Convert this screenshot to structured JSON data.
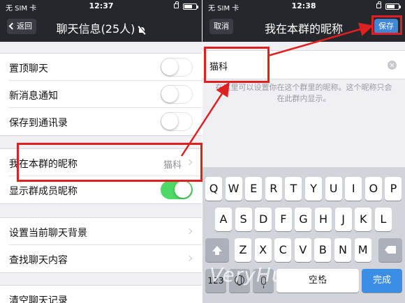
{
  "left": {
    "status": {
      "carrier": "无 SIM 卡",
      "time": "12:37"
    },
    "nav": {
      "back_label": "返回",
      "title": "聊天信息(25人)"
    },
    "groups": [
      {
        "rows": [
          {
            "label": "置顶聊天",
            "toggle": "off"
          },
          {
            "label": "新消息通知",
            "toggle": "off"
          },
          {
            "label": "保存到通讯录",
            "toggle": "off"
          }
        ]
      },
      {
        "rows": [
          {
            "label": "我在本群的昵称",
            "value": "猫科"
          },
          {
            "label": "显示群成员昵称",
            "toggle": "on"
          }
        ]
      },
      {
        "rows": [
          {
            "label": "设置当前聊天背景"
          },
          {
            "label": "查找聊天内容"
          }
        ]
      },
      {
        "rows": [
          {
            "label": "清空聊天记录"
          }
        ]
      }
    ]
  },
  "right": {
    "status": {
      "carrier": "无 SIM 卡",
      "time": "12:38"
    },
    "nav": {
      "cancel_label": "取消",
      "title": "我在本群的昵称",
      "save_label": "保存"
    },
    "field_value": "猫科",
    "hint": "在这里可以设置你在这个群里的昵称。这个昵称只会在此群内显示。",
    "keyboard": {
      "row1": [
        "Q",
        "W",
        "E",
        "R",
        "T",
        "Y",
        "U",
        "I",
        "O",
        "P"
      ],
      "row2": [
        "A",
        "S",
        "D",
        "F",
        "G",
        "H",
        "J",
        "K",
        "L"
      ],
      "row3": [
        "Z",
        "X",
        "C",
        "V",
        "B",
        "N",
        "M"
      ],
      "numbers_label": "123",
      "space_label": "空格",
      "done_label": "完成"
    }
  },
  "watermark": "VeryHuo.com",
  "colors": {
    "nav_bg": "#25272c",
    "toggle_on": "#4cd964",
    "save_blue": "#3f88d8",
    "annotation_red": "#e02020"
  }
}
